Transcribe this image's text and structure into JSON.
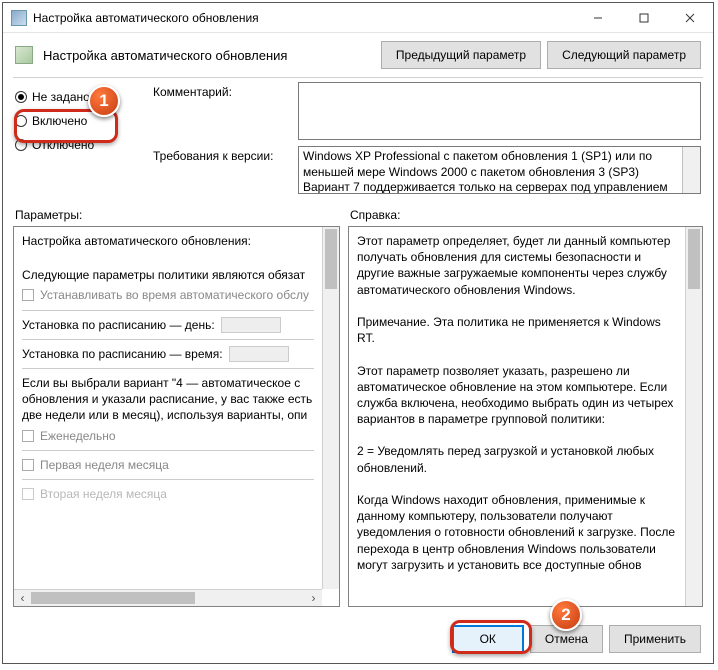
{
  "window": {
    "title": "Настройка автоматического обновления",
    "subtitle": "Настройка автоматического обновления"
  },
  "nav": {
    "prev": "Предыдущий параметр",
    "next": "Следующий параметр"
  },
  "radios": {
    "not_set": "Не задано",
    "enabled": "Включено",
    "disabled": "Отключено"
  },
  "labels": {
    "comment": "Комментарий:",
    "requirements": "Требования к версии:",
    "parameters": "Параметры:",
    "help": "Справка:"
  },
  "requirements_text": "Windows XP Professional с пакетом обновления 1 (SP1) или по меньшей мере Windows 2000 с пакетом обновления 3 (SP3)\nВариант 7 поддерживается только на серверах под управлением",
  "options": {
    "title": "Настройка автоматического обновления:",
    "mandatory_note": "Следующие параметры политики являются обязат",
    "install_maint": "Устанавливать во время автоматического обслу",
    "sched_day": "Установка по расписанию — день:",
    "sched_time": "Установка по расписанию — время:",
    "variant_note": "Если вы выбрали вариант \"4 — автоматическое с обновления и указали расписание, у вас также есть две недели или в месяц), используя варианты, опи",
    "weekly": "Еженедельно",
    "first_week": "Первая неделя месяца",
    "second_week": "Вторая неделя месяца"
  },
  "help_text": "Этот параметр определяет, будет ли данный компьютер получать обновления для системы безопасности и другие важные загружаемые компоненты через службу автоматического обновления Windows.\n\nПримечание. Эта политика не применяется к Windows RT.\n\nЭтот параметр позволяет указать, разрешено ли автоматическое обновление на этом компьютере. Если служба включена, необходимо выбрать один из четырех вариантов в параметре групповой политики:\n\n    2 = Уведомлять перед загрузкой и установкой любых обновлений.\n\n    Когда Windows находит обновления, применимые к данному компьютеру, пользователи получают уведомления о готовности обновлений к загрузке. После перехода в центр обновления Windows пользователи могут загрузить и установить все доступные обнов",
  "buttons": {
    "ok": "ОК",
    "cancel": "Отмена",
    "apply": "Применить"
  },
  "annotations": {
    "one": "1",
    "two": "2"
  }
}
